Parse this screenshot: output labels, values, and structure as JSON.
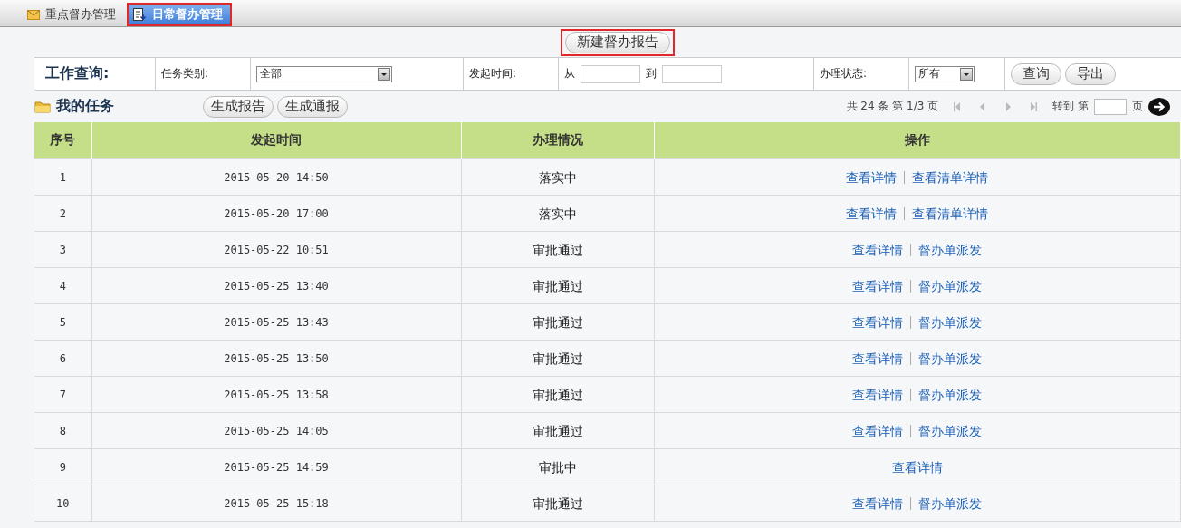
{
  "tabs": [
    {
      "label": "重点督办管理",
      "selected": false,
      "highlighted": false
    },
    {
      "label": "日常督办管理",
      "selected": true,
      "highlighted": true
    }
  ],
  "new_button": {
    "label": "新建督办报告",
    "highlighted": true
  },
  "query": {
    "title": "工作查询:",
    "fields": [
      {
        "kind": "select",
        "label": "任务类别:",
        "value": "全部"
      },
      {
        "kind": "range",
        "label": "发起时间:",
        "from": "从",
        "to": "到"
      },
      {
        "kind": "select",
        "label": "办理状态:",
        "value": "所有"
      }
    ],
    "buttons": [
      "查询",
      "导出"
    ]
  },
  "my_tasks": {
    "title": "我的任务",
    "buttons": [
      "生成报告",
      "生成通报"
    ]
  },
  "pagination": {
    "summary": "共 24 条 第 1/3 页",
    "goto": "转到 第",
    "page_unit": "页"
  },
  "table": {
    "columns": [
      "序号",
      "发起时间",
      "办理情况",
      "操作"
    ],
    "rows": [
      {
        "index": "1",
        "time": "2015-05-20 14:50",
        "status": "落实中",
        "actions": [
          "查看详情",
          "查看清单详情"
        ]
      },
      {
        "index": "2",
        "time": "2015-05-20 17:00",
        "status": "落实中",
        "actions": [
          "查看详情",
          "查看清单详情"
        ]
      },
      {
        "index": "3",
        "time": "2015-05-22 10:51",
        "status": "审批通过",
        "actions": [
          "查看详情",
          "督办单派发"
        ]
      },
      {
        "index": "4",
        "time": "2015-05-25 13:40",
        "status": "审批通过",
        "actions": [
          "查看详情",
          "督办单派发"
        ]
      },
      {
        "index": "5",
        "time": "2015-05-25 13:43",
        "status": "审批通过",
        "actions": [
          "查看详情",
          "督办单派发"
        ]
      },
      {
        "index": "6",
        "time": "2015-05-25 13:50",
        "status": "审批通过",
        "actions": [
          "查看详情",
          "督办单派发"
        ]
      },
      {
        "index": "7",
        "time": "2015-05-25 13:58",
        "status": "审批通过",
        "actions": [
          "查看详情",
          "督办单派发"
        ]
      },
      {
        "index": "8",
        "time": "2015-05-25 14:05",
        "status": "审批通过",
        "actions": [
          "查看详情",
          "督办单派发"
        ]
      },
      {
        "index": "9",
        "time": "2015-05-25 14:59",
        "status": "审批中",
        "actions": [
          "查看详情"
        ]
      },
      {
        "index": "10",
        "time": "2015-05-25 15:18",
        "status": "审批通过",
        "actions": [
          "查看详情",
          "督办单派发"
        ]
      }
    ]
  }
}
